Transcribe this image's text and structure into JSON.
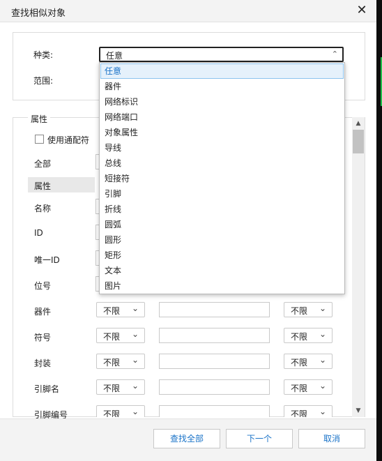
{
  "window": {
    "title": "查找相似对象",
    "close_glyph": "✕"
  },
  "type_field": {
    "label": "种类:",
    "value": "任意",
    "chevron": "⌃"
  },
  "scope_field": {
    "label": "范围:"
  },
  "dropdown": {
    "items": [
      "任意",
      "器件",
      "网络标识",
      "网络端口",
      "对象属性",
      "导线",
      "总线",
      "短接符",
      "引脚",
      "折线",
      "圆弧",
      "圆形",
      "矩形",
      "文本",
      "图片"
    ],
    "selected_index": 0
  },
  "properties": {
    "group_title": "属性",
    "wildcard_label": "使用通配符",
    "wildcard_checked": false,
    "rows": [
      {
        "label": "全部"
      },
      {
        "label": "属性"
      },
      {
        "label": "名称"
      },
      {
        "label": "ID"
      },
      {
        "label": "唯一ID"
      },
      {
        "label": "位号"
      },
      {
        "label": "器件",
        "cond": "不限",
        "text": "",
        "cond2": "不限"
      },
      {
        "label": "符号",
        "cond": "不限",
        "text": "",
        "cond2": "不限"
      },
      {
        "label": "封装",
        "cond": "不限",
        "text": "",
        "cond2": "不限"
      },
      {
        "label": "引脚名",
        "cond": "不限",
        "text": "",
        "cond2": "不限"
      },
      {
        "label": "引脚编号",
        "cond": "不限",
        "text": "",
        "cond2": "不限"
      }
    ],
    "select_chevron": "⌄"
  },
  "scrollbar": {
    "up": "▲",
    "down": "▼"
  },
  "footer": {
    "find_all": "查找全部",
    "next": "下一个",
    "cancel": "取消"
  }
}
